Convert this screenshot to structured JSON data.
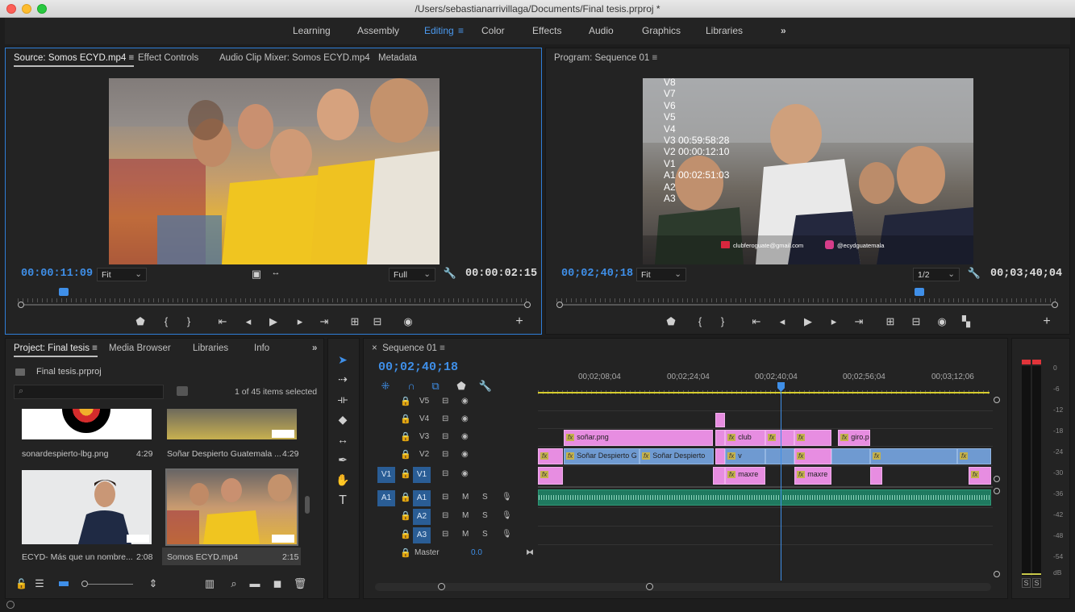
{
  "window": {
    "title": "/Users/sebastianarrivillaga/Documents/Final tesis.prproj *"
  },
  "workspaces": {
    "items": [
      "Learning",
      "Assembly",
      "Editing",
      "Color",
      "Effects",
      "Audio",
      "Graphics",
      "Libraries"
    ],
    "active": "Editing",
    "menu_glyph": "≡",
    "more": "»"
  },
  "source_panel": {
    "tabs": [
      "Source: Somos ECYD.mp4",
      "Effect Controls",
      "Audio Clip Mixer: Somos ECYD.mp4",
      "Metadata"
    ],
    "menu_glyph": "≡",
    "timecode_current": "00:00:11:09",
    "fit": "Fit",
    "quality": "Full",
    "timecode_duration": "00:00:02:15"
  },
  "program_panel": {
    "tab": "Program: Sequence 01",
    "menu_glyph": "≡",
    "timecode_current": "00;02;40;18",
    "fit": "Fit",
    "quality": "1/2",
    "timecode_duration": "00;03;40;04",
    "overlay": {
      "tracks": [
        "V8",
        "V7",
        "V6",
        "V5",
        "V4",
        "V3 00:59:58:28",
        "V2 00:00:12:10",
        "V1",
        "A1 00:02:51:03",
        "A2",
        "A3"
      ],
      "email": "clubferoguate@gmail.com",
      "instagram": "@ecydguatemala"
    }
  },
  "project_panel": {
    "tabs": [
      "Project: Final tesis",
      "Media Browser",
      "Libraries",
      "Info"
    ],
    "menu_glyph": "≡",
    "more": "»",
    "project_file": "Final tesis.prproj",
    "items_selected": "1 of 45 items selected",
    "items": [
      {
        "name": "sonardespierto-lbg.png",
        "duration": "4:29"
      },
      {
        "name": "Soñar Despierto Guatemala ...",
        "duration": "4:29"
      },
      {
        "name": "ECYD- Más que un nombre...",
        "duration": "2:08"
      },
      {
        "name": "Somos ECYD.mp4",
        "duration": "2:15"
      }
    ]
  },
  "timeline": {
    "tab": "Sequence 01",
    "close_glyph": "×",
    "menu_glyph": "≡",
    "timecode": "00;02;40;18",
    "ruler": [
      "00;02;08;04",
      "00;02;24;04",
      "00;02;40;04",
      "00;02;56;04",
      "00;03;12;06"
    ],
    "video_tracks": [
      "V5",
      "V4",
      "V3",
      "V2",
      "V1"
    ],
    "audio_tracks": [
      "A1",
      "A2",
      "A3"
    ],
    "source_patch_video": "V1",
    "source_patch_audio": "A1",
    "master_label": "Master",
    "master_value": "0.0",
    "clips": {
      "sonar_png": "soñar.png",
      "club": "club",
      "v": "v",
      "giro": "giro.p",
      "sonar_despierto": "Soñar Despierto G",
      "sonar_despierto_2": "Soñar Despierto",
      "maxre1": "maxre",
      "maxre2": "maxre"
    },
    "ms_labels": {
      "m": "M",
      "s": "S"
    },
    "fx_label": "fx"
  },
  "audio_meter": {
    "scale": [
      "0",
      "-6",
      "-12",
      "-18",
      "-24",
      "-30",
      "-36",
      "-42",
      "-48",
      "-54",
      "dB"
    ],
    "solo": [
      "S",
      "S"
    ]
  },
  "colors": {
    "accent_blue": "#3f8fe8",
    "clip_pink": "#e78de1",
    "clip_blue": "#6f9ad1",
    "playhead": "#3f8fe8",
    "audio_clip": "#1f7a60"
  }
}
